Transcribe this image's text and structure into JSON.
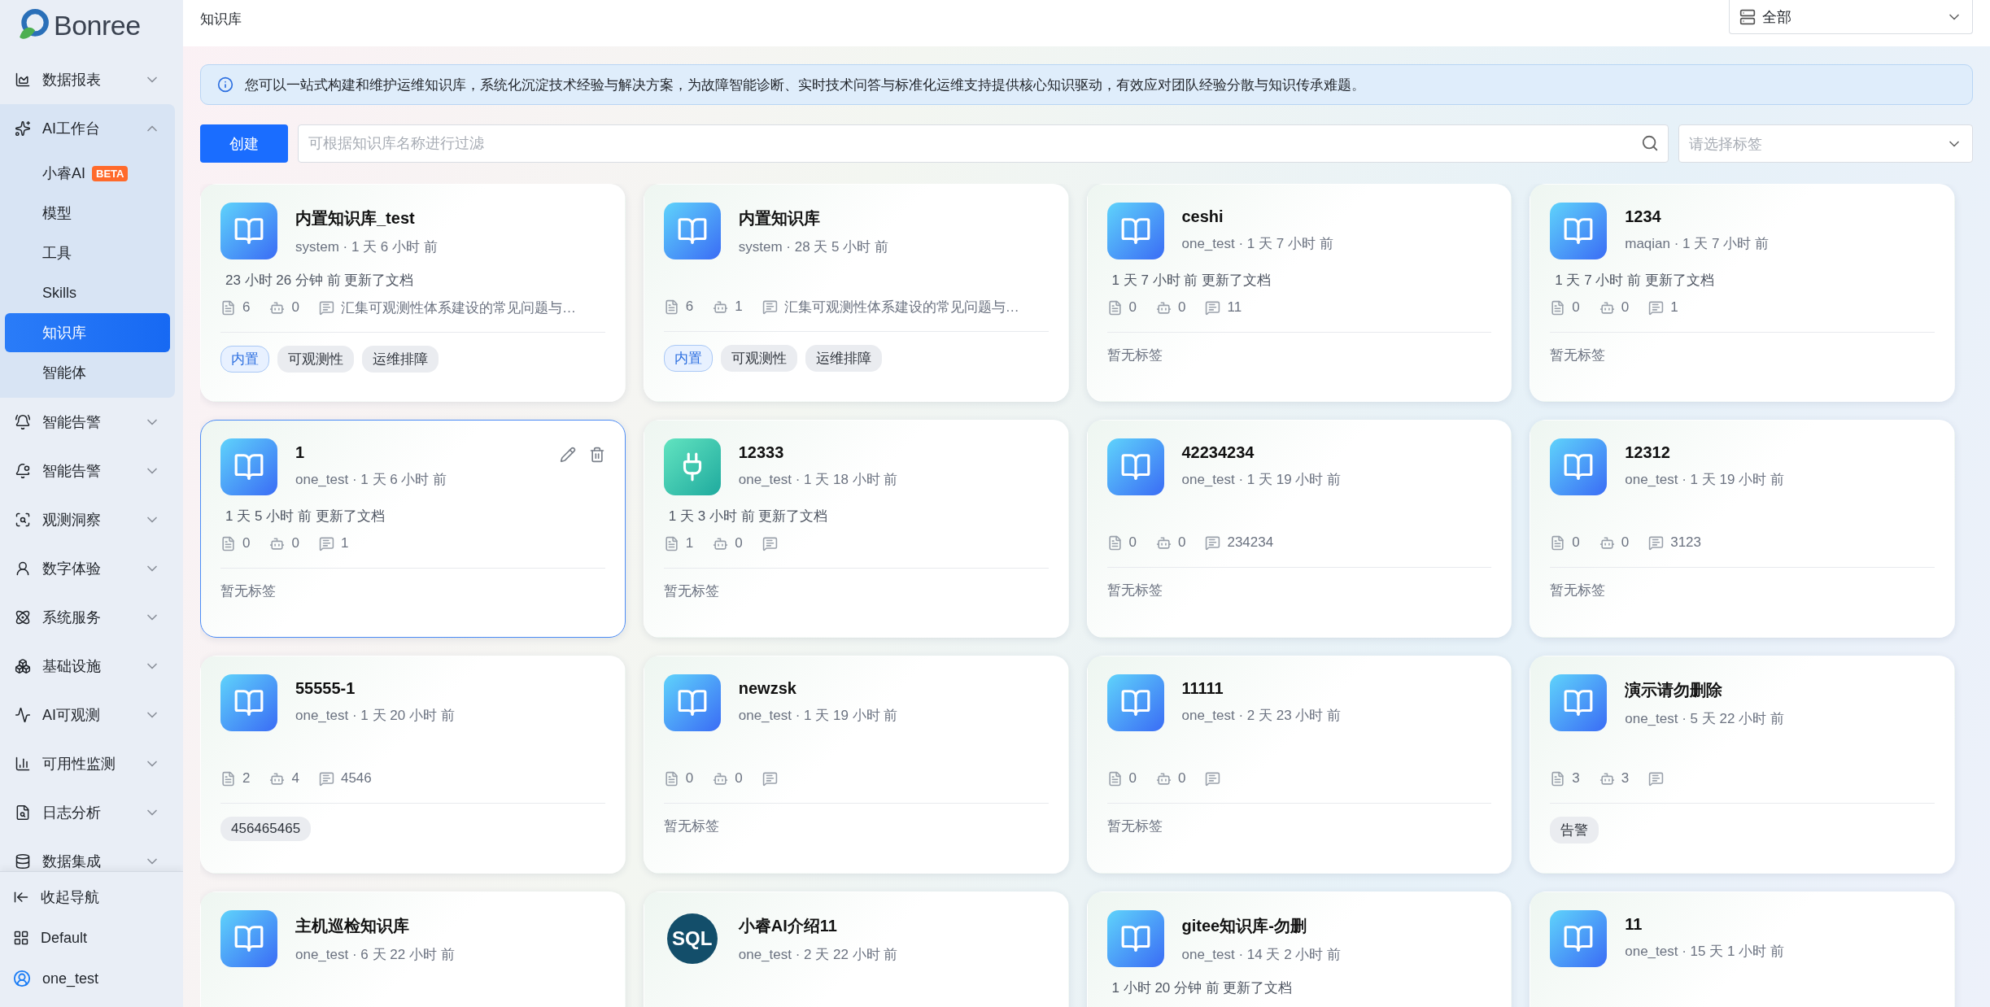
{
  "sidebar": {
    "logo": "Bonree",
    "items": [
      {
        "label": "数据报表",
        "expanded": false
      },
      {
        "label": "AI工作台",
        "expanded": true,
        "children": [
          {
            "label": "小睿AI",
            "badge": "BETA",
            "selected": false
          },
          {
            "label": "模型",
            "selected": false
          },
          {
            "label": "工具",
            "selected": false
          },
          {
            "label": "Skills",
            "selected": false
          },
          {
            "label": "知识库",
            "selected": true
          },
          {
            "label": "智能体",
            "selected": false
          }
        ]
      },
      {
        "label": "智能告警",
        "expanded": false
      },
      {
        "label": "智能告警",
        "expanded": false
      },
      {
        "label": "观测洞察",
        "expanded": false
      },
      {
        "label": "数字体验",
        "expanded": false
      },
      {
        "label": "系统服务",
        "expanded": false
      },
      {
        "label": "基础设施",
        "expanded": false
      },
      {
        "label": "AI可观测",
        "expanded": false
      },
      {
        "label": "可用性监测",
        "expanded": false
      },
      {
        "label": "日志分析",
        "expanded": false
      },
      {
        "label": "数据集成",
        "expanded": false
      }
    ],
    "footer": {
      "collapse": "收起导航",
      "workspace": "Default",
      "user": "one_test"
    }
  },
  "header": {
    "title": "知识库",
    "scope_select": "全部"
  },
  "banner": "您可以一站式构建和维护运维知识库，系统化沉淀技术经验与解决方案，为故障智能诊断、实时技术问答与标准化运维支持提供核心知识驱动，有效应对团队经验分散与知识传承难题。",
  "toolbar": {
    "create": "创建",
    "search_placeholder": "可根据知识库名称进行过滤",
    "tag_placeholder": "请选择标签"
  },
  "cards": [
    {
      "kind": "book",
      "title": "内置知识库_test",
      "meta": "system · 1 天 6 小时 前",
      "updated": "23 小时 26 分钟 前 更新了文档",
      "docs": "6",
      "bots": "0",
      "qa": "汇集可观测性体系建设的常见问题与…",
      "selected": false,
      "tags": [
        {
          "label": "内置",
          "kind": "builtin"
        },
        {
          "label": "可观测性",
          "kind": "plain"
        },
        {
          "label": "运维排障",
          "kind": "plain"
        }
      ]
    },
    {
      "kind": "book",
      "title": "内置知识库",
      "meta": "system · 28 天 5 小时 前",
      "docs": "6",
      "bots": "1",
      "qa": "汇集可观测性体系建设的常见问题与…",
      "selected": false,
      "tags": [
        {
          "label": "内置",
          "kind": "builtin"
        },
        {
          "label": "可观测性",
          "kind": "plain"
        },
        {
          "label": "运维排障",
          "kind": "plain"
        }
      ]
    },
    {
      "kind": "book",
      "title": "ceshi",
      "meta": "one_test · 1 天 7 小时 前",
      "updated": "1 天 7 小时 前 更新了文档",
      "docs": "0",
      "bots": "0",
      "qa": "11",
      "selected": false,
      "no_tags": "暂无标签"
    },
    {
      "kind": "book",
      "title": "1234",
      "meta": "maqian · 1 天 7 小时 前",
      "updated": "1 天 7 小时 前 更新了文档",
      "docs": "0",
      "bots": "0",
      "qa": "1",
      "selected": false,
      "no_tags": "暂无标签"
    },
    {
      "kind": "book",
      "title": "1",
      "meta": "one_test · 1 天 6 小时 前",
      "updated": "1 天 5 小时 前 更新了文档",
      "docs": "0",
      "bots": "0",
      "qa": "1",
      "selected": true,
      "no_tags": "暂无标签"
    },
    {
      "kind": "plug",
      "title": "12333",
      "meta": "one_test · 1 天 18 小时 前",
      "updated": "1 天 3 小时 前 更新了文档",
      "docs": "1",
      "bots": "0",
      "selected": false,
      "no_tags": "暂无标签"
    },
    {
      "kind": "book",
      "title": "42234234",
      "meta": "one_test · 1 天 19 小时 前",
      "docs": "0",
      "bots": "0",
      "qa": "234234",
      "selected": false,
      "no_tags": "暂无标签"
    },
    {
      "kind": "book",
      "title": "12312",
      "meta": "one_test · 1 天 19 小时 前",
      "docs": "0",
      "bots": "0",
      "qa": "3123",
      "selected": false,
      "no_tags": "暂无标签"
    },
    {
      "kind": "book",
      "title": "55555-1",
      "meta": "one_test · 1 天 20 小时 前",
      "docs": "2",
      "bots": "4",
      "qa": "4546",
      "selected": false,
      "tags": [
        {
          "label": "456465465",
          "kind": "plain"
        }
      ]
    },
    {
      "kind": "book",
      "title": "newzsk",
      "meta": "one_test · 1 天 19 小时 前",
      "docs": "0",
      "bots": "0",
      "selected": false,
      "no_tags": "暂无标签"
    },
    {
      "kind": "book",
      "title": "11111",
      "meta": "one_test · 2 天 23 小时 前",
      "docs": "0",
      "bots": "0",
      "selected": false,
      "no_tags": "暂无标签"
    },
    {
      "kind": "book",
      "title": "演示请勿删除",
      "meta": "one_test · 5 天 22 小时 前",
      "docs": "3",
      "bots": "3",
      "selected": false,
      "tags": [
        {
          "label": "告警",
          "kind": "plain"
        }
      ]
    },
    {
      "kind": "book",
      "title": "主机巡检知识库",
      "meta": "one_test · 6 天 22 小时 前",
      "selected": false
    },
    {
      "kind": "sql",
      "logo_text": "SQL",
      "title": "小睿AI介绍11",
      "meta": "one_test · 2 天 22 小时 前",
      "selected": false
    },
    {
      "kind": "book",
      "title": "gitee知识库-勿删",
      "meta": "one_test · 14 天 2 小时 前",
      "updated": "1 小时 20 分钟 前 更新了文档",
      "selected": false
    },
    {
      "kind": "book",
      "title": "11",
      "meta": "one_test · 15 天 1 小时 前",
      "selected": false
    }
  ]
}
